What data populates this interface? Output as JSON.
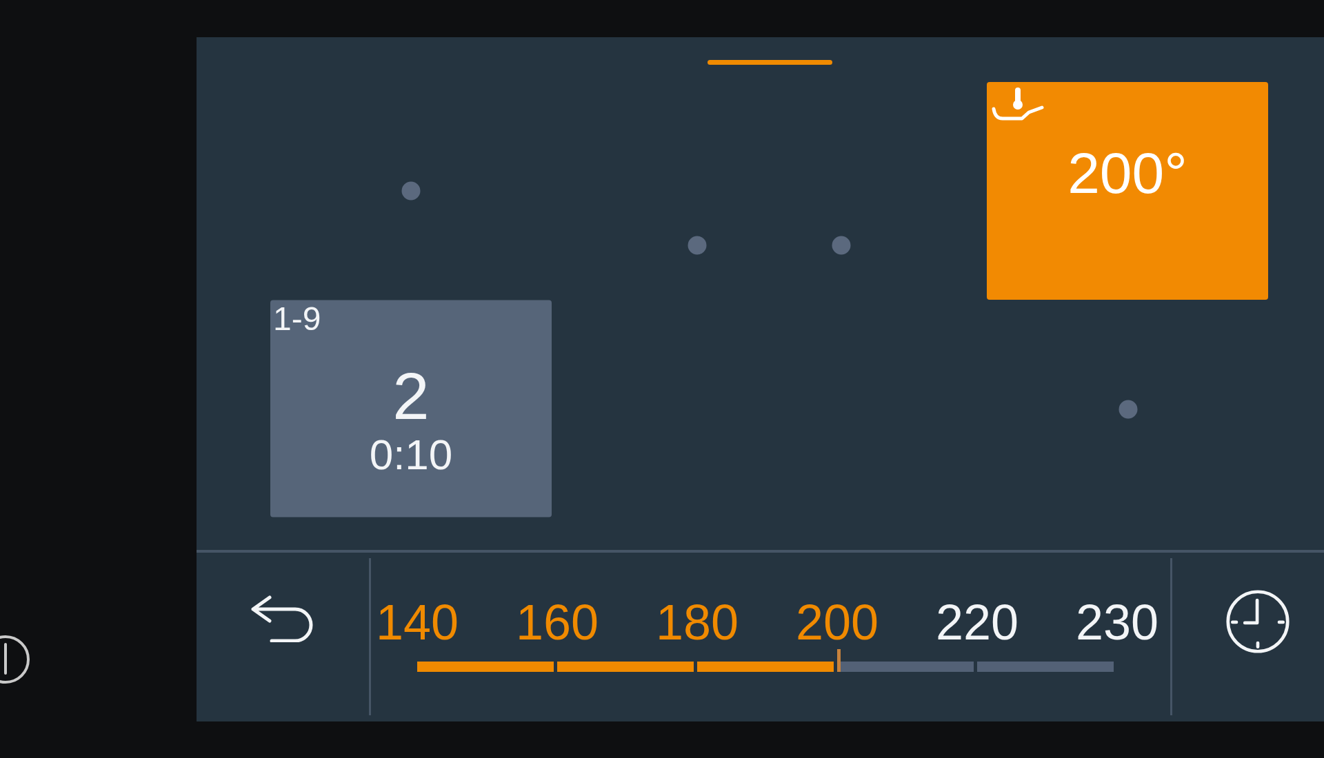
{
  "cooking_zones": [
    {
      "kind": "inactive",
      "selected": false
    },
    {
      "kind": "temperature",
      "selected": true,
      "value": "200°"
    },
    {
      "kind": "inactive",
      "selected": false
    },
    {
      "kind": "inactive",
      "selected": false
    },
    {
      "kind": "power",
      "selected": false,
      "range": "1-9",
      "power_level": "2",
      "timer": "0:10"
    },
    {
      "kind": "inactive",
      "selected": false
    }
  ],
  "temperature_scale": {
    "ticks": [
      "140",
      "160",
      "180",
      "200",
      "220",
      "230"
    ],
    "level": 0.6
  }
}
